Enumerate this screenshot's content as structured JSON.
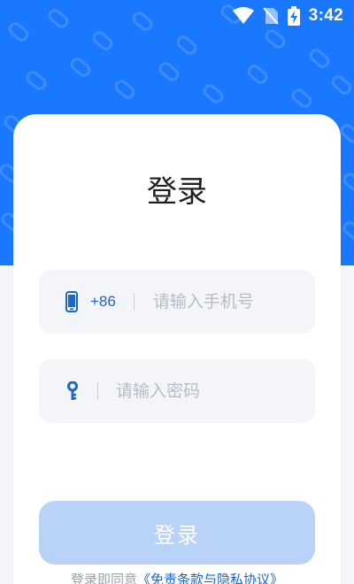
{
  "status_bar": {
    "time": "3:42",
    "icons": [
      "wifi-icon",
      "no-sim-icon",
      "battery-charging-icon"
    ]
  },
  "login": {
    "title": "登录",
    "phone": {
      "icon": "phone-icon",
      "country_code": "+86",
      "placeholder": "请输入手机号",
      "value": ""
    },
    "password": {
      "icon": "key-icon",
      "placeholder": "请输入密码",
      "value": ""
    },
    "submit_label": "登录",
    "agreement": {
      "prefix": "登录即同意",
      "link": "《免责条款与隐私协议》"
    }
  },
  "colors": {
    "brand": "#1a78ff",
    "accent": "#1e66c8",
    "button_disabled": "#b8d3f7",
    "field_bg": "#f3f5f8"
  }
}
